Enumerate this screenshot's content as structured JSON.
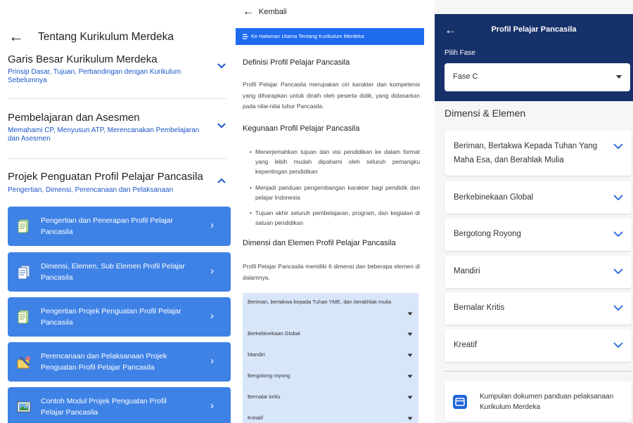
{
  "panel1": {
    "back_arrow": "←",
    "title": "Tentang Kurikulum Merdeka",
    "sections": [
      {
        "title": "Garis Besar Kurikulum Merdeka",
        "subtitle": "Prinsip Dasar, Tujuan, Perbandingan dengan Kurikulum Sebelumnya",
        "expanded": false
      },
      {
        "title": "Pembelajaran dan Asesmen",
        "subtitle": "Memahami CP, Menyusun ATP, Merencanakan Pembelajaran dan Asesmen",
        "expanded": false
      },
      {
        "title": "Projek Penguatan Profil Pelajar Pancasila",
        "subtitle": "Pengertian, Dimensi, Perencanaan dan Pelaksanaan",
        "expanded": true
      }
    ],
    "items": [
      {
        "label": "Pengertian dan Penerapan Profil Pelajar Pancasila",
        "icon": "document-icon",
        "arrow": "›"
      },
      {
        "label": "Dimensi, Elemen, Sub Elemen Profil Pelajar Pancasila",
        "icon": "documents-stack-icon",
        "arrow": "›"
      },
      {
        "label": "Pengertian Projek Penguatan Profil Pelajar Pancasila",
        "icon": "document-icon",
        "arrow": "›"
      },
      {
        "label": "Perencanaan dan Pelaksanaan Projek Penguatan Profil Pelajar Pancasila",
        "icon": "planning-icon",
        "arrow": "›"
      },
      {
        "label": "Contoh Modul Projek Penguatan Profil Pelajar Pancasila",
        "icon": "picture-icon",
        "arrow": "›"
      }
    ]
  },
  "panel2": {
    "back_arrow": "←",
    "back_label": "Kembali",
    "home_link": "Ke Halaman Utama Tentang Kurikulum Merdeka",
    "heading1": "Definisi Profil Pelajar Pancasila",
    "para1": "Profil Pelajar Pancasila merupakan ciri karakter dan kompetensi yang diharapkan untuk diraih oleh peserta didik, yang didasarkan pada nilai-nilai luhur Pancasila.",
    "heading2": "Kegunaan Profil Pelajar Pancasila",
    "bullets": [
      "Menerjemahkan tujuan dan visi pendidikan ke dalam format yang lebih mudah dipahami oleh seluruh pemangku kepentingan pendidikan",
      "Menjadi panduan pengembangan karakter bagi pendidik dan pelajar Indonesia",
      "Tujuan akhir seluruh pembelajaran, program, dan kegiatan di satuan pendidikan"
    ],
    "bullet_mark": "•",
    "heading3": "Dimensi dan Elemen Profil Pelajar Pancasila",
    "para2": "Profil Pelajar Pancasila memiliki 6 dimensi dan beberapa elemen di dalamnya.",
    "dimensions": [
      "Beriman, bertakwa kepada Tuhan YME, dan berakhlak mulia",
      "Berkebinekaan Global",
      "Mandiri",
      "Bergotong royong",
      "Bernalar kritis",
      "Kreatif"
    ]
  },
  "panel3": {
    "back_arrow": "←",
    "title": "Profil Pelajar Pancasila",
    "fase_label": "Pilih Fase",
    "fase_value": "Fase C",
    "section_title": "Dimensi & Elemen",
    "cards": [
      "Beriman, Bertakwa Kepada Tuhan Yang Maha Esa, dan Berahlak Mulia",
      "Berkebinekaan Global",
      "Bergotong Royong",
      "Mandiri",
      "Bernalar Kritis",
      "Kreatif"
    ],
    "doc_link": "Kumpulan dokumen panduan pelaksanaan Kurikulum Merdeka",
    "accent_color": "#17316a"
  },
  "colors": {
    "primary_blue": "#3f82e6",
    "link_blue": "#1a56c8",
    "list_bg": "#d8e6fa"
  }
}
